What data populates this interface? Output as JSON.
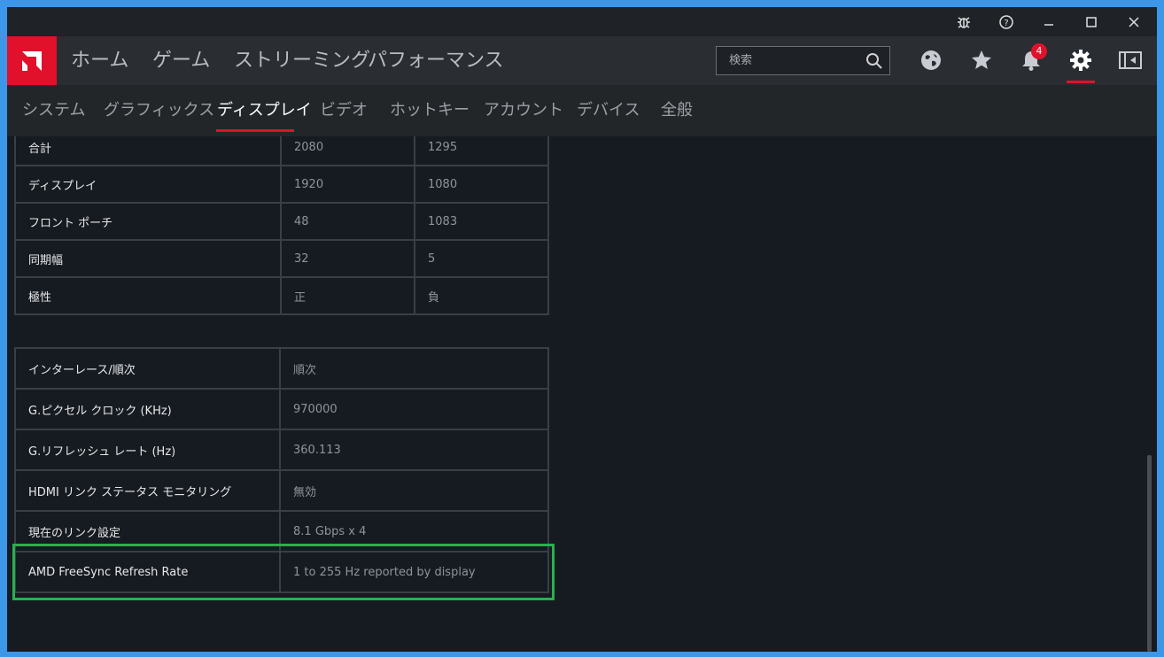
{
  "titlebar": {
    "icons": [
      "bug-icon",
      "help-icon",
      "minimize-icon",
      "maximize-icon",
      "close-icon"
    ]
  },
  "topnav": {
    "items": [
      "ホーム",
      "ゲーム",
      "ストリーミング",
      "パフォーマンス"
    ],
    "search_placeholder": "検索",
    "notification_count": "4",
    "icons": [
      "globe-icon",
      "star-icon",
      "bell-icon",
      "gear-icon",
      "sidebar-icon"
    ]
  },
  "subnav": {
    "items": [
      "システム",
      "グラフィックス",
      "ディスプレイ",
      "ビデオ",
      "ホットキー",
      "アカウント",
      "デバイス",
      "全般"
    ],
    "active": "ディスプレイ"
  },
  "timing_table": {
    "rows": [
      {
        "label": "合計",
        "h": "2080",
        "v": "1295"
      },
      {
        "label": "ディスプレイ",
        "h": "1920",
        "v": "1080"
      },
      {
        "label": "フロント ポーチ",
        "h": "48",
        "v": "1083"
      },
      {
        "label": "同期幅",
        "h": "32",
        "v": "5"
      },
      {
        "label": "極性",
        "h": "正",
        "v": "負"
      }
    ]
  },
  "info_table": {
    "rows": [
      {
        "label": "インターレース/順次",
        "value": "順次"
      },
      {
        "label": "G.ピクセル クロック (KHz)",
        "value": "970000"
      },
      {
        "label": "G.リフレッシュ レート (Hz)",
        "value": "360.113"
      },
      {
        "label": "HDMI リンク ステータス モニタリング",
        "value": "無効"
      },
      {
        "label": "現在のリンク設定",
        "value": "8.1 Gbps x 4"
      },
      {
        "label": "AMD FreeSync Refresh Rate",
        "value": "1 to 255 Hz reported by display"
      }
    ]
  },
  "colors": {
    "accent": "#e2112b",
    "highlight": "#26b14f",
    "background": "#161b22"
  }
}
